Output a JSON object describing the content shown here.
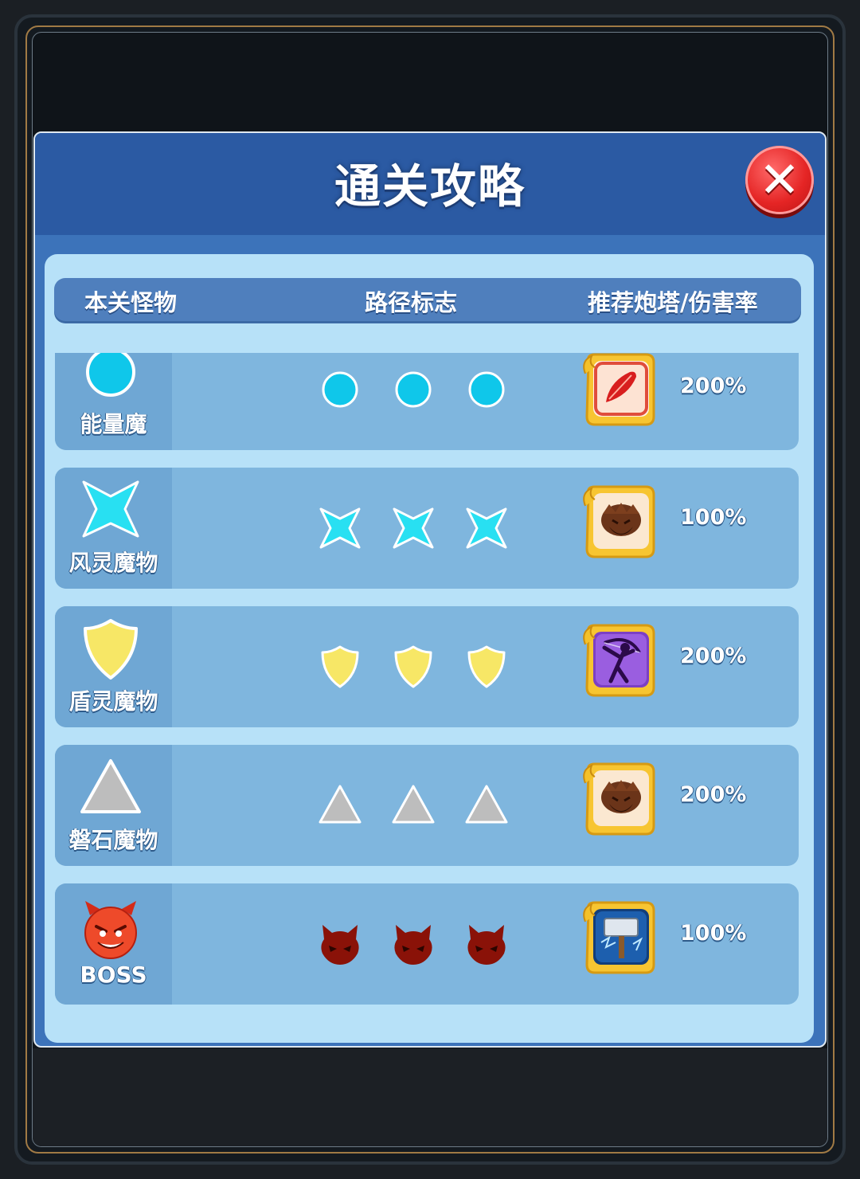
{
  "panel": {
    "title": "通关攻略",
    "close_label": "✕"
  },
  "columns": {
    "monster": "本关怪物",
    "path": "路径标志",
    "tower": "推荐炮塔/伤害率"
  },
  "rows": [
    {
      "name": "能量魔",
      "mark": "cyan-circle",
      "tower_icon": "red-feather-tower-icon",
      "rate": "200%"
    },
    {
      "name": "风灵魔物",
      "mark": "cyan-star",
      "tower_icon": "brown-beast-tower-icon",
      "rate": "100%"
    },
    {
      "name": "盾灵魔物",
      "mark": "yellow-shield",
      "tower_icon": "purple-archer-tower-icon",
      "rate": "200%"
    },
    {
      "name": "磐石魔物",
      "mark": "gray-triangle",
      "tower_icon": "brown-beast-tower-icon",
      "rate": "200%"
    },
    {
      "name": "BOSS",
      "mark": "red-devil",
      "tower_icon": "thunder-hammer-tower-icon",
      "rate": "100%"
    }
  ],
  "colors": {
    "panel_blue": "#3c73ba",
    "header_blue": "#2b5aa3",
    "content_bg": "#b7e1f8",
    "row_bg": "#7fb6de",
    "cyan": "#0fc7ea",
    "yellow": "#f7e766",
    "gray": "#bdbdbd",
    "devil_red": "#8a1208"
  }
}
